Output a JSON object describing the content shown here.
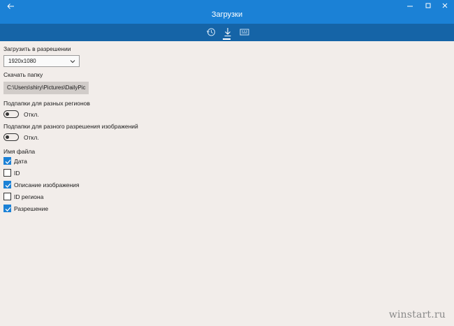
{
  "window": {
    "title": "Загрузки",
    "accent_color": "#1b81d6",
    "nav_color": "#1564a7"
  },
  "nav": {
    "items": [
      {
        "icon": "history-icon",
        "active": false
      },
      {
        "icon": "download-icon",
        "active": true
      },
      {
        "icon": "gallery-icon",
        "active": false
      }
    ]
  },
  "settings": {
    "resolution_label": "Загрузить в разрешении",
    "resolution_value": "1920x1080",
    "folder_label": "Скачать папку",
    "folder_value": "C:\\Users\\shiry\\Pictures\\DailyPic",
    "region_label": "Подпапки для разных регионов",
    "region_toggle": "Откл.",
    "resolution_sub_label": "Подпапки для разного разрешения изображений",
    "resolution_sub_toggle": "Откл.",
    "filename_label": "Имя файла",
    "filename_options": [
      {
        "label": "Дата",
        "checked": true
      },
      {
        "label": "ID",
        "checked": false
      },
      {
        "label": "Описание изображения",
        "checked": true
      },
      {
        "label": "ID региона",
        "checked": false
      },
      {
        "label": "Разрешение",
        "checked": true
      }
    ]
  },
  "watermark": "winstart.ru"
}
